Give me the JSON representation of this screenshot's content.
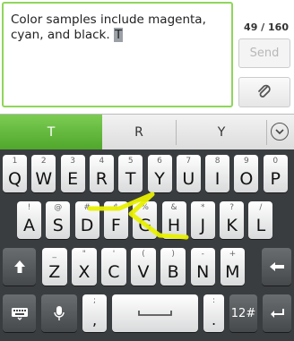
{
  "compose": {
    "message_text": "Color samples include magenta, cyan, and black. ",
    "cursor_char": "T",
    "counter": "49 / 160",
    "send_label": "Send"
  },
  "suggestions": {
    "items": [
      "T",
      "R",
      "Y"
    ],
    "active_index": 0
  },
  "keyboard": {
    "row1": [
      {
        "main": "Q",
        "hint": "1"
      },
      {
        "main": "W",
        "hint": "2"
      },
      {
        "main": "E",
        "hint": "3"
      },
      {
        "main": "R",
        "hint": "4"
      },
      {
        "main": "T",
        "hint": "5"
      },
      {
        "main": "Y",
        "hint": "6"
      },
      {
        "main": "U",
        "hint": "7"
      },
      {
        "main": "I",
        "hint": "8"
      },
      {
        "main": "O",
        "hint": "9"
      },
      {
        "main": "P",
        "hint": "0"
      }
    ],
    "row2": [
      {
        "main": "A",
        "hint": "!"
      },
      {
        "main": "S",
        "hint": "@"
      },
      {
        "main": "D",
        "hint": "#"
      },
      {
        "main": "F",
        "hint": "$"
      },
      {
        "main": "G",
        "hint": "%"
      },
      {
        "main": "H",
        "hint": "&"
      },
      {
        "main": "J",
        "hint": "*"
      },
      {
        "main": "K",
        "hint": "?"
      },
      {
        "main": "L",
        "hint": "/"
      }
    ],
    "row3": [
      {
        "main": "Z",
        "hint": "_"
      },
      {
        "main": "X",
        "hint": "\""
      },
      {
        "main": "C",
        "hint": "'"
      },
      {
        "main": "V",
        "hint": "("
      },
      {
        "main": "B",
        "hint": ")"
      },
      {
        "main": "N",
        "hint": "-"
      },
      {
        "main": "M",
        "hint": "+"
      }
    ],
    "comma": ",",
    "comma_hint": ";",
    "period": ".",
    "period_hint": ":",
    "symbols_label": "12#"
  },
  "colors": {
    "accent_green": "#5cb536",
    "trail_yellow": "#e8f000",
    "keyboard_bg": "#3a3d40"
  },
  "icons": [
    "paperclip-icon",
    "chevron-down-icon",
    "shift-icon",
    "backspace-icon",
    "keyboard-icon",
    "microphone-icon",
    "space-icon",
    "enter-icon"
  ]
}
